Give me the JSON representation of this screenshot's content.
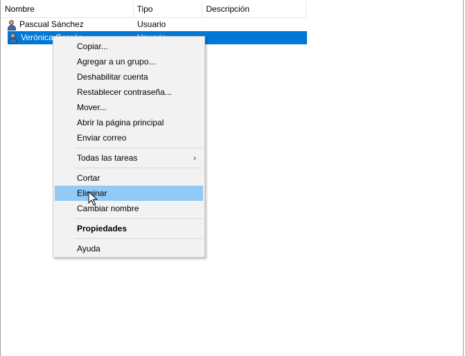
{
  "columns": [
    "Nombre",
    "Tipo",
    "Descripción"
  ],
  "rows": [
    {
      "name": "Pascual Sánchez",
      "type": "Usuario",
      "icon": "user-icon"
    },
    {
      "name": "Verónica Garcés",
      "type": "Usuario",
      "icon": "user-icon",
      "selected": true
    }
  ],
  "context_menu": {
    "items": [
      {
        "label": "Copiar..."
      },
      {
        "label": "Agregar a un grupo..."
      },
      {
        "label": "Deshabilitar cuenta"
      },
      {
        "label": "Restablecer contraseña..."
      },
      {
        "label": "Mover..."
      },
      {
        "label": "Abrir la página principal"
      },
      {
        "label": "Enviar correo"
      },
      {
        "label": "Todas las tareas",
        "submenu": true
      },
      {
        "label": "Cortar"
      },
      {
        "label": "Eliminar",
        "highlighted": true
      },
      {
        "label": "Cambiar nombre"
      },
      {
        "label": "Propiedades",
        "bold": true
      },
      {
        "label": "Ayuda"
      }
    ],
    "submenu_arrow": "›"
  },
  "colors": {
    "selection": "#0078d7",
    "menu_highlight": "#91c9f7",
    "menu_background": "#f2f2f2"
  }
}
